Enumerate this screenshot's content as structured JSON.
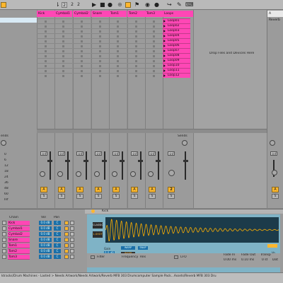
{
  "transport": {
    "numbers": [
      "2",
      "2",
      "2"
    ],
    "play_symbol": "▶",
    "stop_symbol": "■",
    "record_symbol": "●"
  },
  "tracks": [
    {
      "name": "Kick"
    },
    {
      "name": "Cymbal1"
    },
    {
      "name": "Cymbal2"
    },
    {
      "name": "Snare"
    },
    {
      "name": "Tom1"
    },
    {
      "name": "Tom2"
    },
    {
      "name": "Tom3"
    }
  ],
  "loops_track": {
    "name": "Loops",
    "clips": [
      "Loop01",
      "Loop02",
      "Loop03",
      "Loop04",
      "Loop05",
      "Loop06",
      "Loop07",
      "Loop08",
      "Loop09",
      "Loop10",
      "Loop11",
      "Loop12"
    ]
  },
  "drop_text": "Drop Files and Devices Here",
  "return_track": {
    "name": "A Reverb"
  },
  "mixer": {
    "sends_label": "Sends",
    "left_sends_label": "ends",
    "db_ticks": [
      "0",
      "6",
      "12",
      "18",
      "24",
      "36",
      "48",
      "60",
      "Inf"
    ],
    "track_volume": "-inf",
    "return_volume": "-inf",
    "activator_label": "A",
    "loops_number": "2",
    "loops_volume": "-inf",
    "solo_label": "S",
    "accent_color": "#ffb72e"
  },
  "device": {
    "title": "Kick",
    "chain_header": "Chain",
    "vol_header": "Vol",
    "pan_header": "Pan",
    "chains": [
      {
        "name": "Kick",
        "vol": "0.0 dB",
        "pan": "C"
      },
      {
        "name": "Cymbal1",
        "vol": "0.0 dB",
        "pan": "C"
      },
      {
        "name": "Cymbal2",
        "vol": "0.0 dB",
        "pan": "C"
      },
      {
        "name": "Snare",
        "vol": "0.0 dB",
        "pan": "C"
      },
      {
        "name": "Tom1",
        "vol": "0.0 dB",
        "pan": "C"
      },
      {
        "name": "Tom2",
        "vol": "0.0 dB",
        "pan": "C"
      },
      {
        "name": "Tom3",
        "vol": "0.0 dB",
        "pan": "C"
      }
    ],
    "filter_label": "Filter",
    "frequency_label": "Frequency",
    "res_label": "Res",
    "classic_label": "CLASSIC",
    "oneshot_label": "1-SHOT",
    "gain_label": "Gain",
    "gain_value": "0.0 dB",
    "warp_label": "WARP",
    "snap_label": "SNAP",
    "warp_sub": "WARP",
    "lfo_label": "LFO",
    "fade_in_label": "Fade In",
    "fade_in_value": "0.00 ms",
    "fade_out_label": "Fade Out",
    "fade_out_value": "0.10 ms",
    "transp_label": "Transp",
    "transp_value": "0 st",
    "vol_label": "Vo",
    "dot_label": "Dot",
    "waveform_color": "#ffb000",
    "waveform_bg": "#1c3b4a",
    "device_bg": "#7fb3c6"
  },
  "statusbar": {
    "path": "ktracks/Drum Machines - Lasted > Needs Artwork/Needs Artwork/Reverb MFB 303 Drumcomputer Sample Pack...Assets/Reverb MFB 303 Dru"
  }
}
